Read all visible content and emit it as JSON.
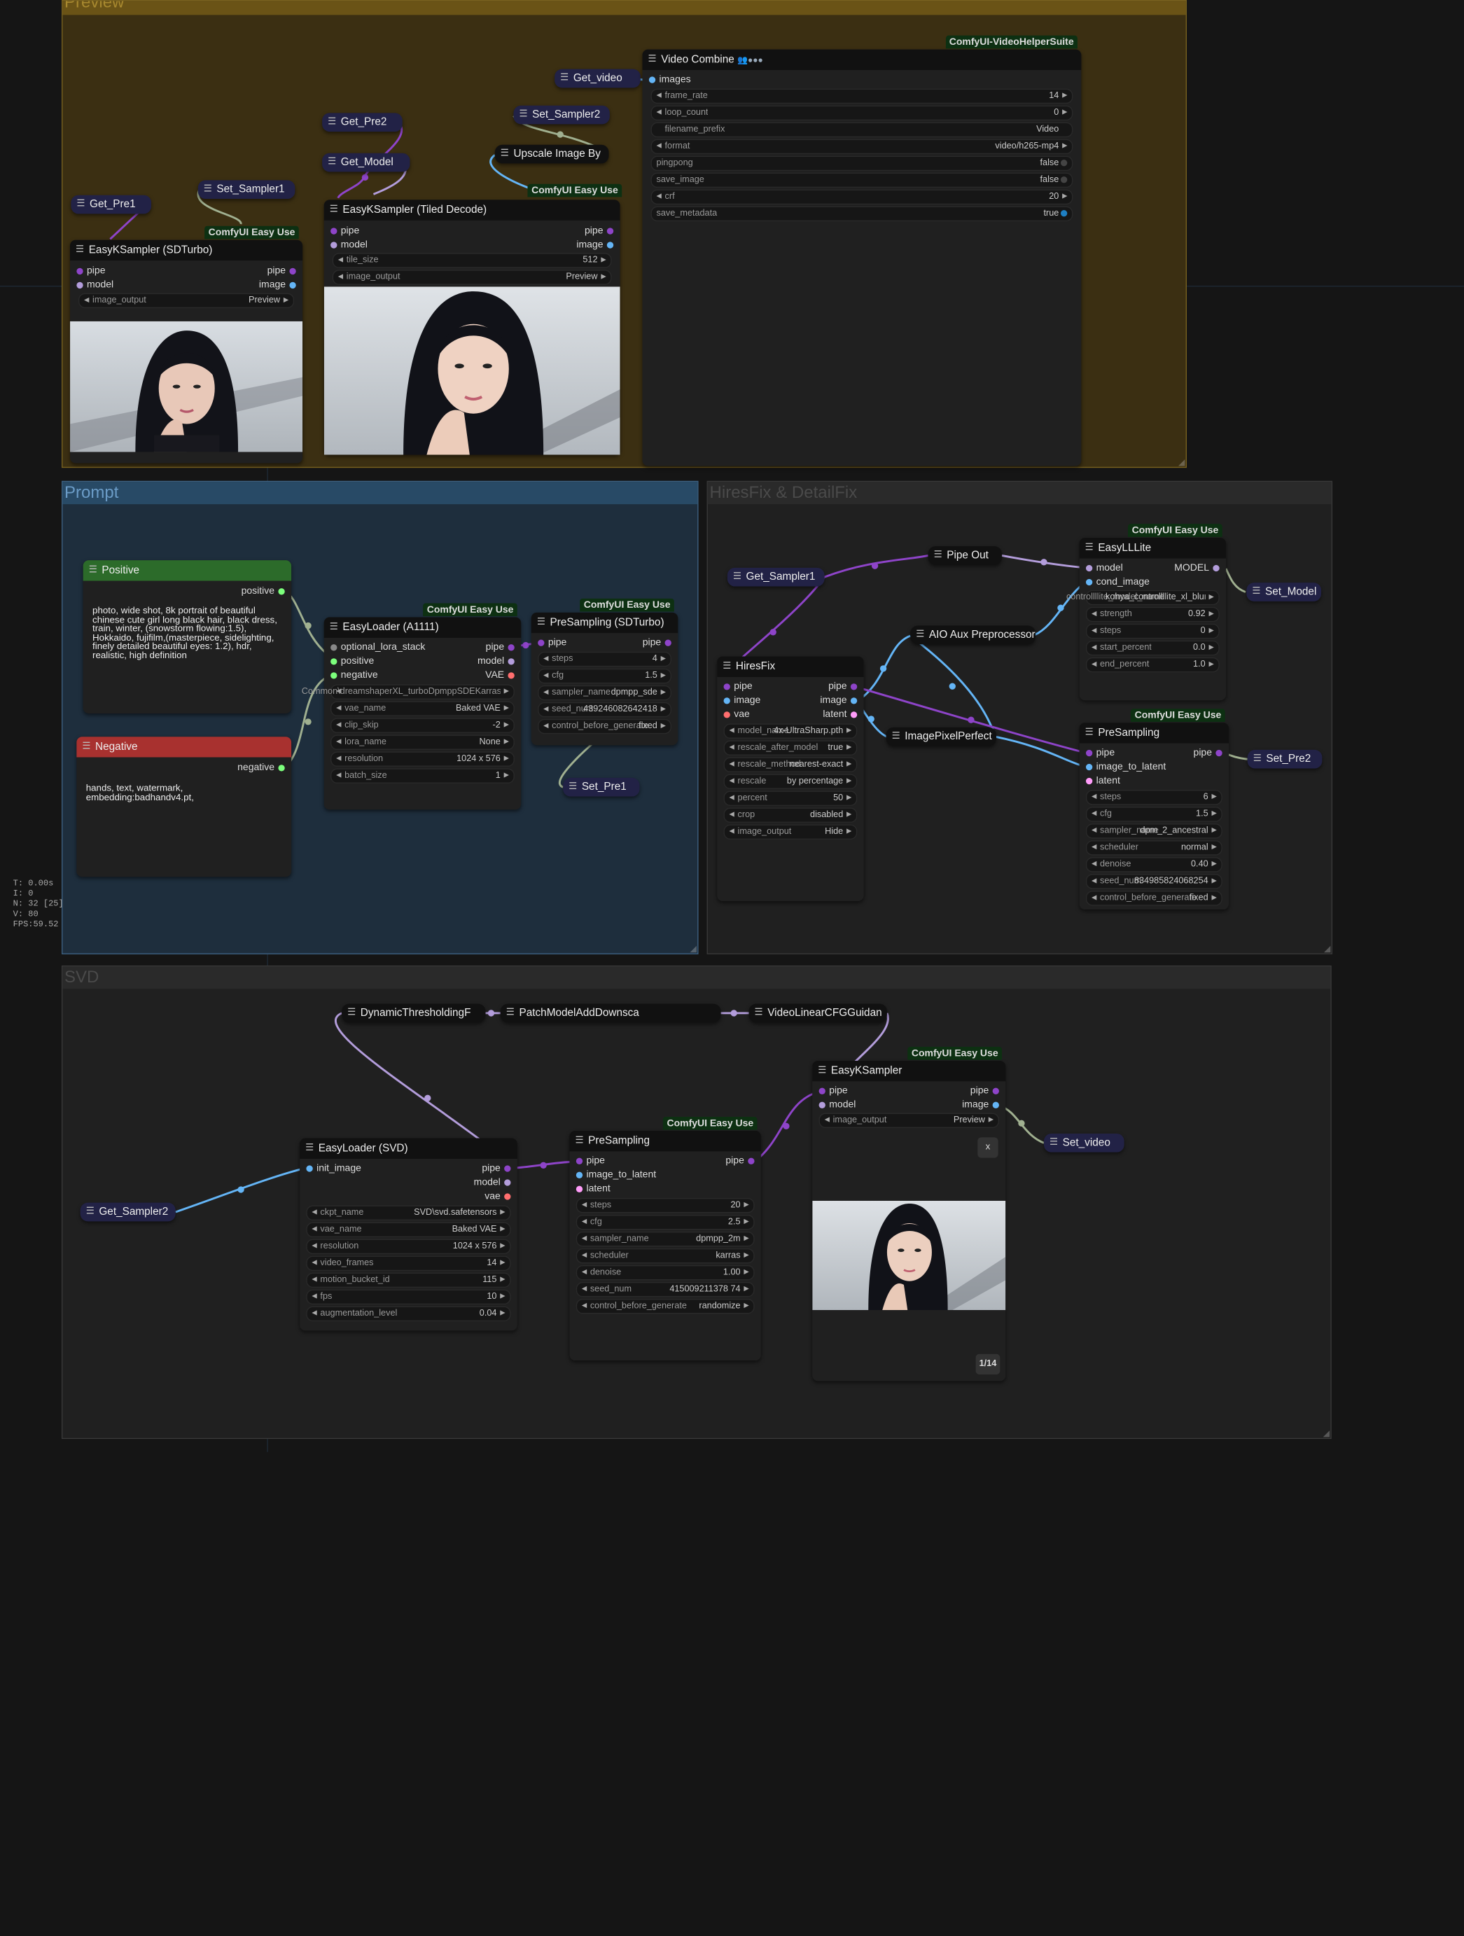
{
  "stats": {
    "t": "T: 0.00s",
    "i": "I: 0",
    "n": "N: 32 [25]",
    "v": "V: 80",
    "fps": "FPS:59.52"
  },
  "groups": {
    "preview": "Preview",
    "prompt": "Prompt",
    "hires": "HiresFix & DetailFix",
    "svd": "SVD"
  },
  "badges": {
    "easy": "ComfyUI Easy Use",
    "vhs": "ComfyUI-VideoHelperSuite"
  },
  "nodes": {
    "get_pre1": "Get_Pre1",
    "set_sampler1": "Set_Sampler1",
    "get_pre2": "Get_Pre2",
    "get_model": "Get_Model",
    "set_sampler2": "Set_Sampler2",
    "upscale": "Upscale Image By",
    "get_video": "Get_video",
    "sdturbo": {
      "title": "EasyKSampler (SDTurbo)",
      "in_pipe": "pipe",
      "in_model": "model",
      "out_pipe": "pipe",
      "out_image": "image",
      "w_image_output": "image_output",
      "v_image_output": "Preview"
    },
    "tiled": {
      "title": "EasyKSampler (Tiled Decode)",
      "in_pipe": "pipe",
      "in_model": "model",
      "out_pipe": "pipe",
      "out_image": "image",
      "w_tile_size": "tile_size",
      "v_tile_size": "512",
      "w_image_output": "image_output",
      "v_image_output": "Preview"
    },
    "video_combine": {
      "title": "Video Combine",
      "icons": "👥●●●",
      "in_images": "images",
      "widgets": [
        {
          "name": "frame_rate",
          "value": "14"
        },
        {
          "name": "loop_count",
          "value": "0"
        },
        {
          "name": "filename_prefix",
          "value": "Video"
        },
        {
          "name": "format",
          "value": "video/h265-mp4"
        },
        {
          "name": "pingpong",
          "value": "false"
        },
        {
          "name": "save_image",
          "value": "false"
        },
        {
          "name": "crf",
          "value": "20"
        },
        {
          "name": "save_metadata",
          "value": "true"
        }
      ]
    },
    "positive": {
      "title": "Positive",
      "out": "positive",
      "text": "photo, wide shot, 8k portrait of beautiful chinese cute girl long black hair, black dress, train, winter, (snowstorm flowing:1.5), Hokkaido, fujifilm,(masterpiece, sidelighting, finely detailed beautiful eyes: 1.2), hdr, realistic, high definition"
    },
    "negative": {
      "title": "Negative",
      "out": "negative",
      "text": "hands, text, watermark, embedding:badhandv4.pt,"
    },
    "loader_a1111": {
      "title": "EasyLoader (A1111)",
      "in_lora": "optional_lora_stack",
      "in_pos": "positive",
      "in_neg": "negative",
      "out_pipe": "pipe",
      "out_model": "model",
      "out_vae": "VAE",
      "widgets": [
        {
          "name": "Common\\dreamshaperXL_turboDpmppSDEKarras.safetensors",
          "value": ""
        },
        {
          "name": "vae_name",
          "value": "Baked VAE"
        },
        {
          "name": "clip_skip",
          "value": "-2"
        },
        {
          "name": "lora_name",
          "value": "None"
        },
        {
          "name": "resolution",
          "value": "1024 x 576"
        },
        {
          "name": "batch_size",
          "value": "1"
        }
      ]
    },
    "presampling_sdturbo": {
      "title": "PreSampling (SDTurbo)",
      "in_pipe": "pipe",
      "out_pipe": "pipe",
      "widgets": [
        {
          "name": "steps",
          "value": "4"
        },
        {
          "name": "cfg",
          "value": "1.5"
        },
        {
          "name": "sampler_name",
          "value": "dpmpp_sde"
        },
        {
          "name": "seed_num",
          "value": "439246082642418"
        },
        {
          "name": "control_before_generate",
          "value": "fixed"
        }
      ]
    },
    "set_pre1": "Set_Pre1",
    "get_sampler1": "Get_Sampler1",
    "pipe_out": "Pipe Out",
    "easyllite": {
      "title": "EasyLLLite",
      "in_model": "model",
      "in_cond": "cond_image",
      "out_model": "MODEL",
      "widgets": [
        {
          "name": "controllllite_model_name",
          "value": "kohya_controllllite_xl_blur_anime_beta.safetensors"
        },
        {
          "name": "strength",
          "value": "0.92"
        },
        {
          "name": "steps",
          "value": "0"
        },
        {
          "name": "start_percent",
          "value": "0.0"
        },
        {
          "name": "end_percent",
          "value": "1.0"
        }
      ]
    },
    "set_model": "Set_Model",
    "aio": "AIO Aux Preprocessor",
    "hiresfix": {
      "title": "HiresFix",
      "in_pipe": "pipe",
      "in_image": "image",
      "in_vae": "vae",
      "out_pipe": "pipe",
      "out_image": "image",
      "out_latent": "latent",
      "widgets": [
        {
          "name": "model_name",
          "value": "4x-UltraSharp.pth"
        },
        {
          "name": "rescale_after_model",
          "value": "true"
        },
        {
          "name": "rescale_method",
          "value": "nearest-exact"
        },
        {
          "name": "rescale",
          "value": "by percentage"
        },
        {
          "name": "percent",
          "value": "50"
        },
        {
          "name": "crop",
          "value": "disabled"
        },
        {
          "name": "image_output",
          "value": "Hide"
        }
      ]
    },
    "imagepixelperfect": "ImagePixelPerfect",
    "presampling_h": {
      "title": "PreSampling",
      "in_pipe": "pipe",
      "in_itl": "image_to_latent",
      "in_latent": "latent",
      "out_pipe": "pipe",
      "widgets": [
        {
          "name": "steps",
          "value": "6"
        },
        {
          "name": "cfg",
          "value": "1.5"
        },
        {
          "name": "sampler_name",
          "value": "dpm_2_ancestral"
        },
        {
          "name": "scheduler",
          "value": "normal"
        },
        {
          "name": "denoise",
          "value": "0.40"
        },
        {
          "name": "seed_num",
          "value": "834985824068254"
        },
        {
          "name": "control_before_generate",
          "value": "fixed"
        }
      ]
    },
    "set_pre2": "Set_Pre2",
    "dyn": "DynamicThresholdingF",
    "patch": "PatchModelAddDownsca",
    "vlcfg": "VideoLinearCFGGuidan",
    "easyks": {
      "title": "EasyKSampler",
      "in_pipe": "pipe",
      "in_model": "model",
      "out_pipe": "pipe",
      "out_image": "image",
      "w_image_output": "image_output",
      "v_image_output": "Preview",
      "close": "x",
      "counter": "1/14"
    },
    "set_video": "Set_video",
    "loader_svd": {
      "title": "EasyLoader (SVD)",
      "in_init": "init_image",
      "out_pipe": "pipe",
      "out_model": "model",
      "out_vae": "vae",
      "widgets": [
        {
          "name": "ckpt_name",
          "value": "SVD\\svd.safetensors"
        },
        {
          "name": "vae_name",
          "value": "Baked VAE"
        },
        {
          "name": "resolution",
          "value": "1024 x 576"
        },
        {
          "name": "video_frames",
          "value": "14"
        },
        {
          "name": "motion_bucket_id",
          "value": "115"
        },
        {
          "name": "fps",
          "value": "10"
        },
        {
          "name": "augmentation_level",
          "value": "0.04"
        }
      ]
    },
    "get_sampler2": "Get_Sampler2",
    "presampling_svd": {
      "title": "PreSampling",
      "in_pipe": "pipe",
      "in_itl": "image_to_latent",
      "in_latent": "latent",
      "out_pipe": "pipe",
      "widgets": [
        {
          "name": "steps",
          "value": "20"
        },
        {
          "name": "cfg",
          "value": "2.5"
        },
        {
          "name": "sampler_name",
          "value": "dpmpp_2m"
        },
        {
          "name": "scheduler",
          "value": "karras"
        },
        {
          "name": "denoise",
          "value": "1.00"
        },
        {
          "name": "seed_num",
          "value": "415009211378 74"
        },
        {
          "name": "control_before_generate",
          "value": "randomize"
        }
      ]
    }
  },
  "colors": {
    "pipe": "#8e44c9",
    "model": "#b39ddb",
    "image": "#64b5f6",
    "vae": "#ff6e6e",
    "latent": "#ff9cf9",
    "positive": "#7cff7c",
    "negative": "#ff6666",
    "lora": "#888888",
    "link_gray": "#a0b090"
  }
}
